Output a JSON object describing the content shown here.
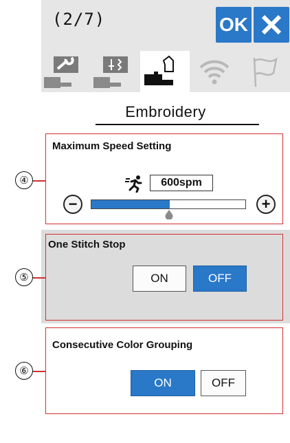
{
  "header": {
    "page_indicator": "(2/7)",
    "ok_label": "OK",
    "close_icon": "close-icon"
  },
  "tabs": [
    {
      "icon": "wrench-machine-icon",
      "active": false
    },
    {
      "icon": "stitch-machine-icon",
      "active": false
    },
    {
      "icon": "embroidery-machine-icon",
      "active": true
    },
    {
      "icon": "wifi-icon",
      "active": false
    },
    {
      "icon": "flag-icon",
      "active": false
    }
  ],
  "page_title": "Embroidery",
  "sections": {
    "speed": {
      "callout": "④",
      "label": "Maximum Speed Setting",
      "value": "600spm",
      "slider_level_percent": 51,
      "minus_label": "−",
      "plus_label": "+"
    },
    "one_stitch": {
      "callout": "⑤",
      "label": "One Stitch Stop",
      "on_label": "ON",
      "off_label": "OFF",
      "selected": "OFF"
    },
    "color_grouping": {
      "callout": "⑥",
      "label": "Consecutive Color Grouping",
      "on_label": "ON",
      "off_label": "OFF",
      "selected": "ON"
    }
  },
  "colors": {
    "accent": "#2a78c8",
    "panel": "#e6e6e6",
    "frame": "#d03030"
  }
}
